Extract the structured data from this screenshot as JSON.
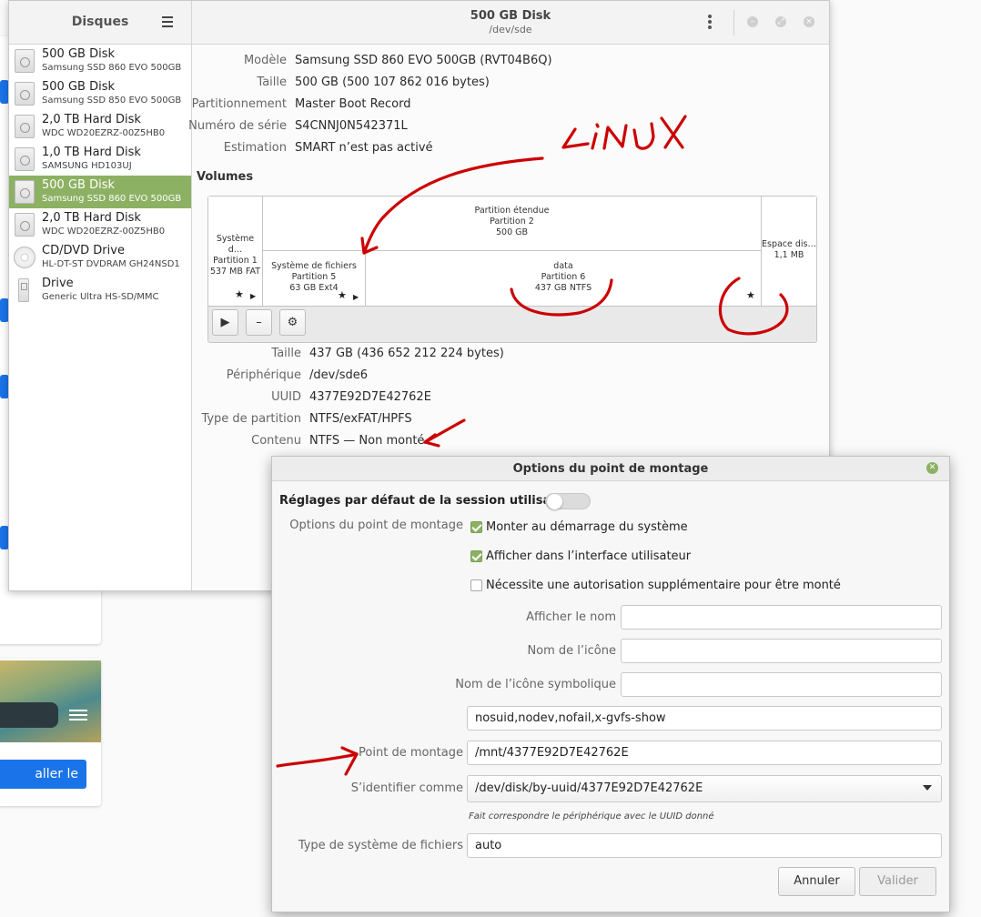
{
  "background_page": {
    "theme_button_label": "aller le thème"
  },
  "sidebar": {
    "title": "Disques",
    "items": [
      {
        "name": "500 GB Disk",
        "model": "Samsung SSD 860 EVO 500GB",
        "icon": "hard-disk-icon",
        "selected": false
      },
      {
        "name": "500 GB Disk",
        "model": "Samsung SSD 850 EVO 500GB",
        "icon": "hard-disk-icon",
        "selected": false
      },
      {
        "name": "2,0 TB Hard Disk",
        "model": "WDC WD20EZRZ-00Z5HB0",
        "icon": "hard-disk-icon",
        "selected": false
      },
      {
        "name": "1,0 TB Hard Disk",
        "model": "SAMSUNG HD103UJ",
        "icon": "hard-disk-icon",
        "selected": false
      },
      {
        "name": "500 GB Disk",
        "model": "Samsung SSD 860 EVO 500GB",
        "icon": "hard-disk-icon",
        "selected": true
      },
      {
        "name": "2,0 TB Hard Disk",
        "model": "WDC WD20EZRZ-00Z5HB0",
        "icon": "hard-disk-icon",
        "selected": false
      },
      {
        "name": "CD/DVD Drive",
        "model": "HL-DT-ST DVDRAM GH24NSD1",
        "icon": "optical-disc-icon",
        "selected": false
      },
      {
        "name": "Drive",
        "model": "Generic Ultra HS-SD/MMC",
        "icon": "usb-drive-icon",
        "selected": false
      }
    ]
  },
  "header": {
    "title": "500 GB Disk",
    "subtitle": "/dev/sde",
    "minimize": "–",
    "maximize": "⤢",
    "close": "×"
  },
  "disk_info": [
    {
      "label": "Modèle",
      "value": "Samsung SSD 860 EVO 500GB (RVT04B6Q)"
    },
    {
      "label": "Taille",
      "value": "500 GB (500 107 862 016 bytes)"
    },
    {
      "label": "Partitionnement",
      "value": "Master Boot Record"
    },
    {
      "label": "Numéro de série",
      "value": "S4CNNJ0N542371L"
    },
    {
      "label": "Estimation",
      "value": "SMART n’est pas activé"
    }
  ],
  "volumes": {
    "title": "Volumes",
    "p1": {
      "line1": "Système d…",
      "line2": "Partition 1",
      "line3": "537 MB FAT"
    },
    "extended": {
      "line1": "Partition étendue",
      "line2": "Partition 2",
      "line3": "500 GB"
    },
    "p5": {
      "line1": "Système de fichiers",
      "line2": "Partition 5",
      "line3": "63 GB Ext4"
    },
    "p6": {
      "line1": "data",
      "line2": "Partition 6",
      "line3": "437 GB NTFS"
    },
    "free": {
      "line1": "Espace dis…",
      "line2": "1,1 MB"
    },
    "buttons": {
      "play": "▶",
      "remove": "–",
      "settings": "⚙"
    }
  },
  "partition_info": [
    {
      "label": "Taille",
      "value": "437 GB (436 652 212 224 bytes)"
    },
    {
      "label": "Périphérique",
      "value": "/dev/sde6"
    },
    {
      "label": "UUID",
      "value": "4377E92D7E42762E"
    },
    {
      "label": "Type de partition",
      "value": "NTFS/exFAT/HPFS"
    },
    {
      "label": "Contenu",
      "value": "NTFS — Non monté"
    }
  ],
  "dialog": {
    "title": "Options du point de montage",
    "session_defaults": "Réglages par défaut de la session utilisateur",
    "session_toggle_on": false,
    "mount_options_label": "Options du point de montage",
    "checkboxes": [
      {
        "label": "Monter au démarrage du système",
        "checked": true
      },
      {
        "label": "Afficher dans l’interface utilisateur",
        "checked": true
      },
      {
        "label": "Nécessite une autorisation supplémentaire pour être monté",
        "checked": false
      }
    ],
    "display_name_label": "Afficher le nom",
    "display_name_value": "",
    "icon_name_label": "Nom de l’icône",
    "icon_name_value": "",
    "symbolic_icon_label": "Nom de l’icône symbolique",
    "symbolic_icon_value": "",
    "options_value": "nosuid,nodev,nofail,x-gvfs-show",
    "mount_point_label": "Point de montage",
    "mount_point_value": "/mnt/4377E92D7E42762E",
    "identify_as_label": "S’identifier comme",
    "identify_as_value": "/dev/disk/by-uuid/4377E92D7E42762E",
    "identify_hint": "Fait correspondre le périphérique avec le UUID donné",
    "fs_type_label": "Type de système de fichiers",
    "fs_type_value": "auto",
    "cancel_label": "Annuler",
    "ok_label": "Valider"
  },
  "annotations": {
    "handwritten_text": "LiNUX",
    "color": "#cc0000"
  }
}
